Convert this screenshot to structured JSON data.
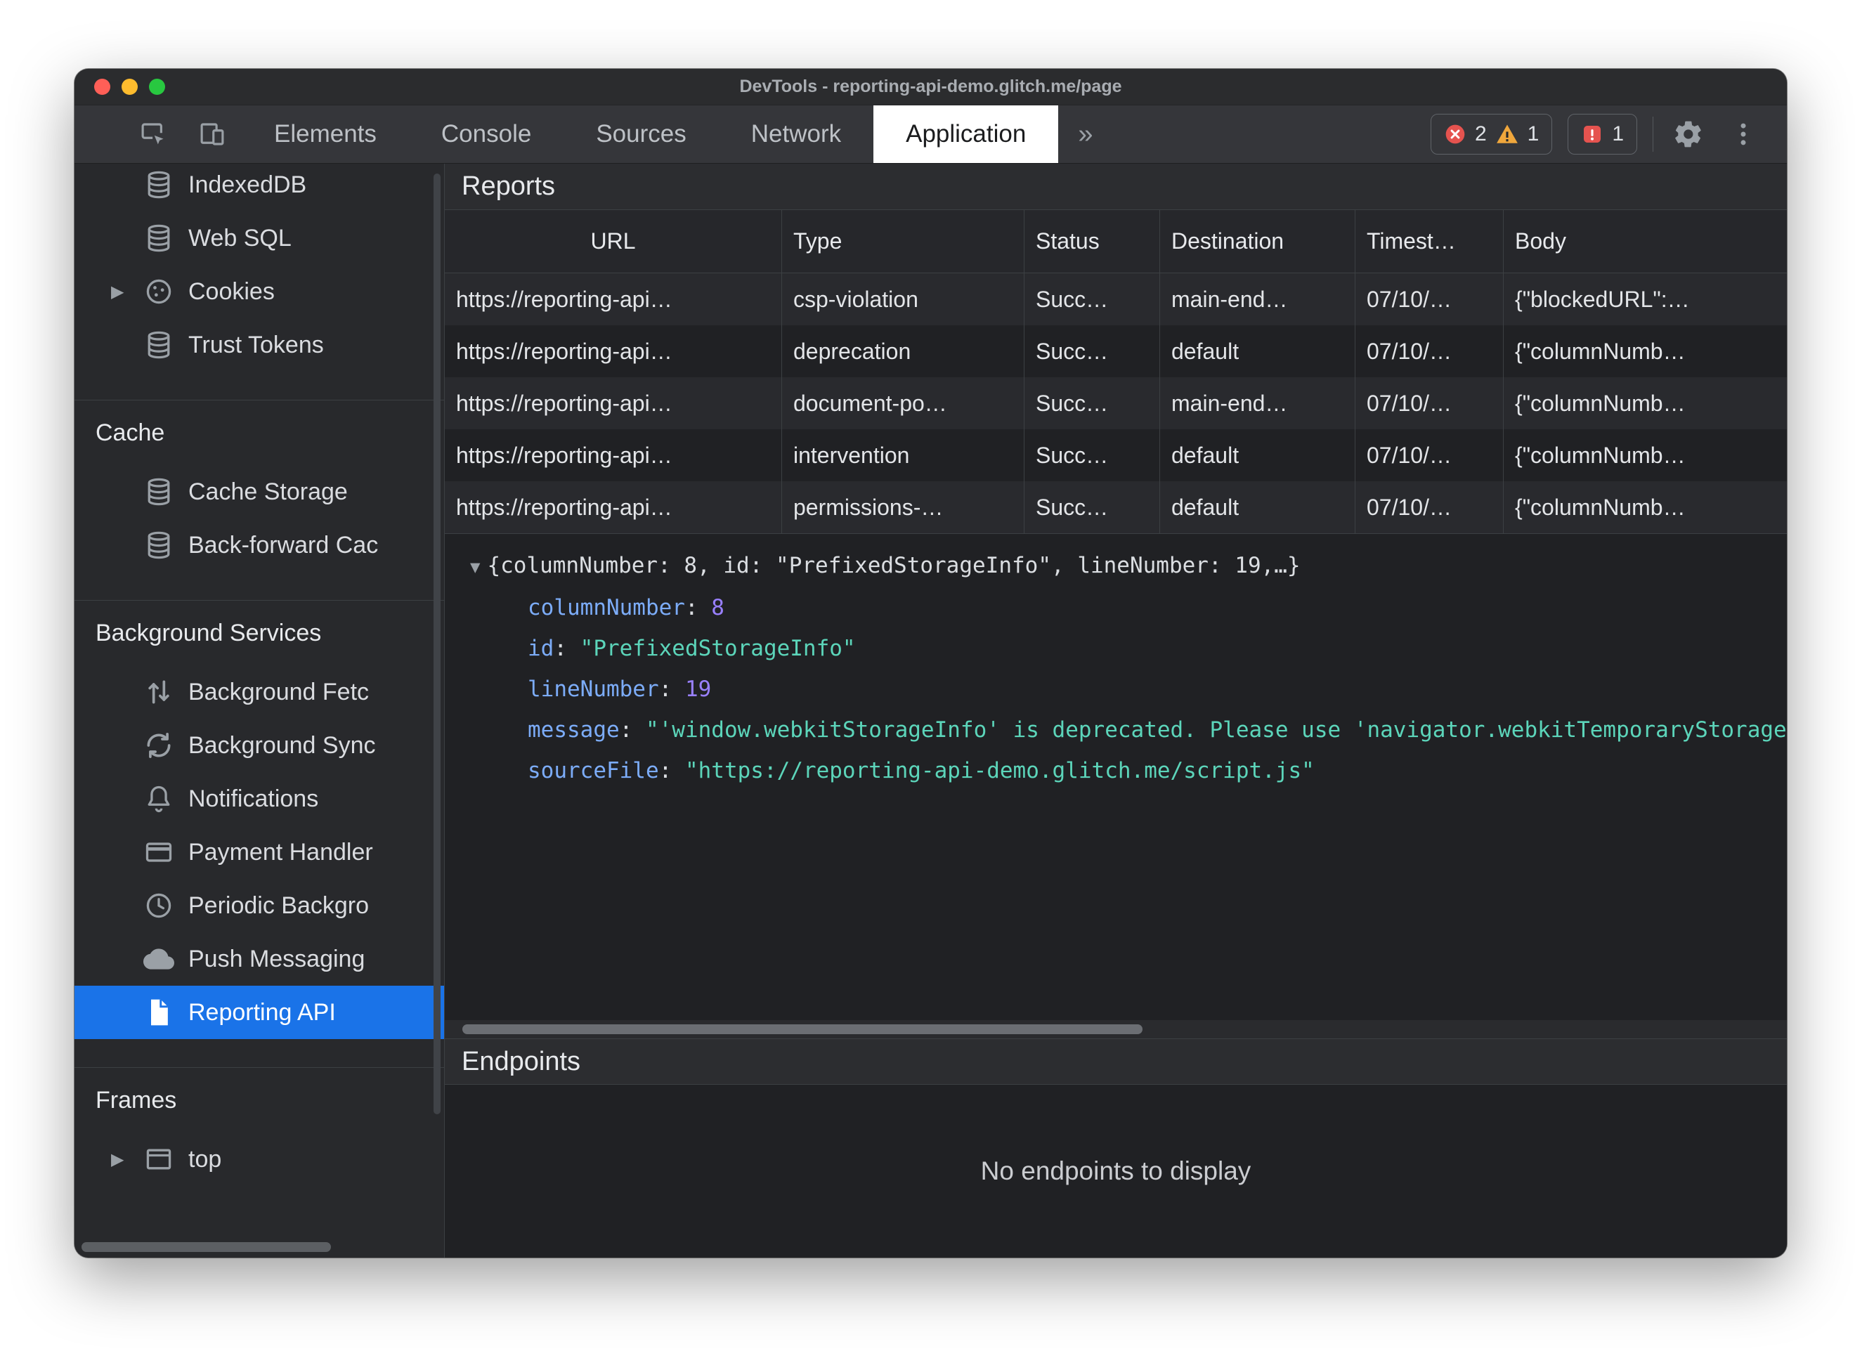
{
  "window": {
    "title": "DevTools - reporting-api-demo.glitch.me/page"
  },
  "tabs": {
    "items": [
      "Elements",
      "Console",
      "Sources",
      "Network",
      "Application"
    ],
    "active": "Application"
  },
  "status": {
    "errors": "2",
    "warnings": "1",
    "issues": "1"
  },
  "icons": {
    "twisty_collapsed": "▶",
    "twisty_expanded": "▼",
    "overflow_chevron": "»"
  },
  "sidebar": {
    "storage_items": [
      {
        "label": "IndexedDB"
      },
      {
        "label": "Web SQL"
      },
      {
        "label": "Cookies"
      },
      {
        "label": "Trust Tokens"
      }
    ],
    "cache": {
      "header": "Cache",
      "items": [
        {
          "label": "Cache Storage"
        },
        {
          "label": "Back-forward Cac"
        }
      ]
    },
    "background": {
      "header": "Background Services",
      "items": [
        {
          "label": "Background Fetc"
        },
        {
          "label": "Background Sync"
        },
        {
          "label": "Notifications"
        },
        {
          "label": "Payment Handler"
        },
        {
          "label": "Periodic Backgro"
        },
        {
          "label": "Push Messaging"
        },
        {
          "label": "Reporting API"
        }
      ]
    },
    "frames": {
      "header": "Frames",
      "items": [
        {
          "label": "top"
        }
      ]
    }
  },
  "reports": {
    "title": "Reports",
    "columns": {
      "url": "URL",
      "type": "Type",
      "status": "Status",
      "destination": "Destination",
      "timestamp": "Timest…",
      "body": "Body"
    },
    "rows": [
      {
        "url": "https://reporting-api…",
        "type": "csp-violation",
        "status": "Succ…",
        "destination": "main-end…",
        "timestamp": "07/10/…",
        "body": "{\"blockedURL\":…"
      },
      {
        "url": "https://reporting-api…",
        "type": "deprecation",
        "status": "Succ…",
        "destination": "default",
        "timestamp": "07/10/…",
        "body": "{\"columnNumb…"
      },
      {
        "url": "https://reporting-api…",
        "type": "document-po…",
        "status": "Succ…",
        "destination": "main-end…",
        "timestamp": "07/10/…",
        "body": "{\"columnNumb…"
      },
      {
        "url": "https://reporting-api…",
        "type": "intervention",
        "status": "Succ…",
        "destination": "default",
        "timestamp": "07/10/…",
        "body": "{\"columnNumb…"
      },
      {
        "url": "https://reporting-api…",
        "type": "permissions-…",
        "status": "Succ…",
        "destination": "default",
        "timestamp": "07/10/…",
        "body": "{\"columnNumb…"
      }
    ]
  },
  "detail": {
    "preview": "{columnNumber: 8, id: \"PrefixedStorageInfo\", lineNumber: 19,…}",
    "properties": [
      {
        "key": "columnNumber",
        "value": "8"
      },
      {
        "key": "id",
        "value": "\"PrefixedStorageInfo\""
      },
      {
        "key": "lineNumber",
        "value": "19"
      },
      {
        "key": "message",
        "value": "\"'window.webkitStorageInfo' is deprecated. Please use 'navigator.webkitTemporaryStorage' or 'navigator.webkitPersistentStorage' instead.\""
      },
      {
        "key": "sourceFile",
        "value": "\"https://reporting-api-demo.glitch.me/script.js\""
      }
    ]
  },
  "endpoints": {
    "title": "Endpoints",
    "empty_message": "No endpoints to display"
  },
  "colors": {
    "accent_blue": "#1a73e8",
    "error_red": "#e5534f",
    "warning_yellow": "#f0a73c",
    "json_key_blue": "#7cacf8",
    "json_number_purple": "#9980ff",
    "json_string_teal": "#5cd5ba"
  }
}
